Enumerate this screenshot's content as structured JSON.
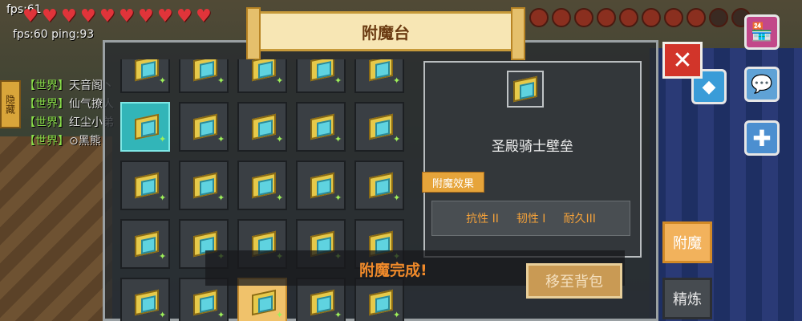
{
  "hud": {
    "fps": "fps:61",
    "net": "fps:60 ping:93",
    "hearts": 10,
    "food_full": 8,
    "food_empty": 2
  },
  "chat": {
    "hide_label": "隐藏",
    "lines": [
      {
        "channel": "【世界】",
        "text": "天音阁丶"
      },
      {
        "channel": "【世界】",
        "text": "仙气撩人"
      },
      {
        "channel": "【世界】",
        "text": "红尘小弟"
      },
      {
        "channel": "【世界】",
        "text": "⊙黑熊"
      }
    ]
  },
  "panel": {
    "title": "附魔台",
    "close_glyph": "✕",
    "selected_item": {
      "name": "圣殿骑士壁垒",
      "effects_label": "附魔效果",
      "effects": [
        "抗性 II",
        "韧性 I",
        "耐久III"
      ]
    },
    "status_message": "附魔完成!",
    "move_button": "移至背包",
    "tabs": [
      "附魔",
      "精炼"
    ]
  },
  "icons": {
    "shop": "shop-icon",
    "chat": "chat-bubble-icon",
    "plus": "plus-icon",
    "gem": "gem-icon"
  },
  "colors": {
    "accent": "#f2b25c",
    "effect_text": "#f3a13a",
    "close": "#d2352a",
    "selected_slot": "#32b5b8"
  }
}
